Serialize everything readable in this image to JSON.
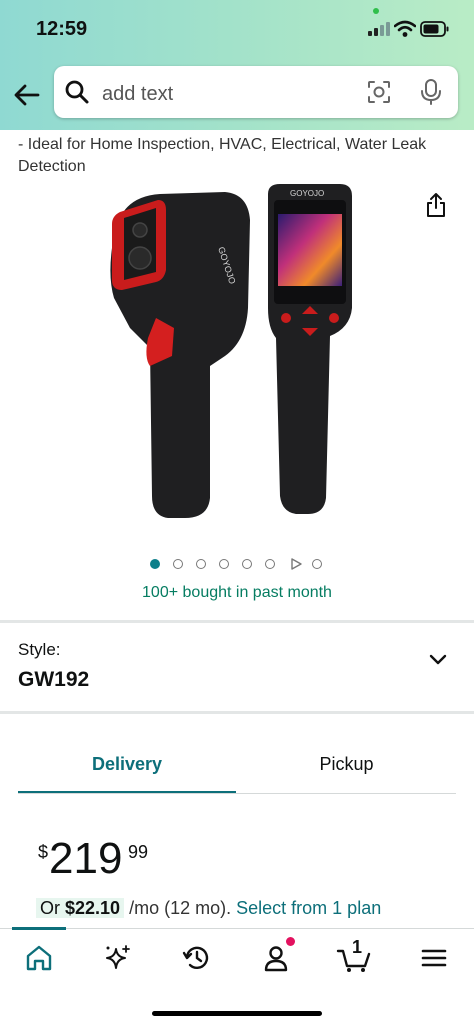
{
  "status_bar": {
    "time": "12:59"
  },
  "search": {
    "placeholder": "add text"
  },
  "product": {
    "description": "- Ideal for Home Inspection, HVAC, Electrical, Water Leak Detection",
    "brand_on_device": "GOYOJO",
    "image_count": 7,
    "active_image_index": 0,
    "bought_text": "100+ bought in past month"
  },
  "style": {
    "label": "Style:",
    "value": "GW192"
  },
  "tabs": [
    {
      "label": "Delivery",
      "selected": true
    },
    {
      "label": "Pickup",
      "selected": false
    }
  ],
  "price": {
    "symbol": "$",
    "whole": "219",
    "fraction": "99",
    "monthly_prefix": "Or",
    "monthly_amount": "$22.10",
    "monthly_suffix": "/mo (12 mo).",
    "select_link": "Select from 1 plan"
  },
  "bottom_nav": {
    "items": [
      {
        "icon": "home-icon",
        "active": true
      },
      {
        "icon": "sparkle-icon"
      },
      {
        "icon": "history-icon"
      },
      {
        "icon": "account-icon"
      },
      {
        "icon": "cart-icon"
      },
      {
        "icon": "menu-icon"
      }
    ],
    "cart_count": "1"
  },
  "colors": {
    "accent": "#0d6f7a",
    "deal_green": "#067d62",
    "notification": "#e3125f"
  }
}
